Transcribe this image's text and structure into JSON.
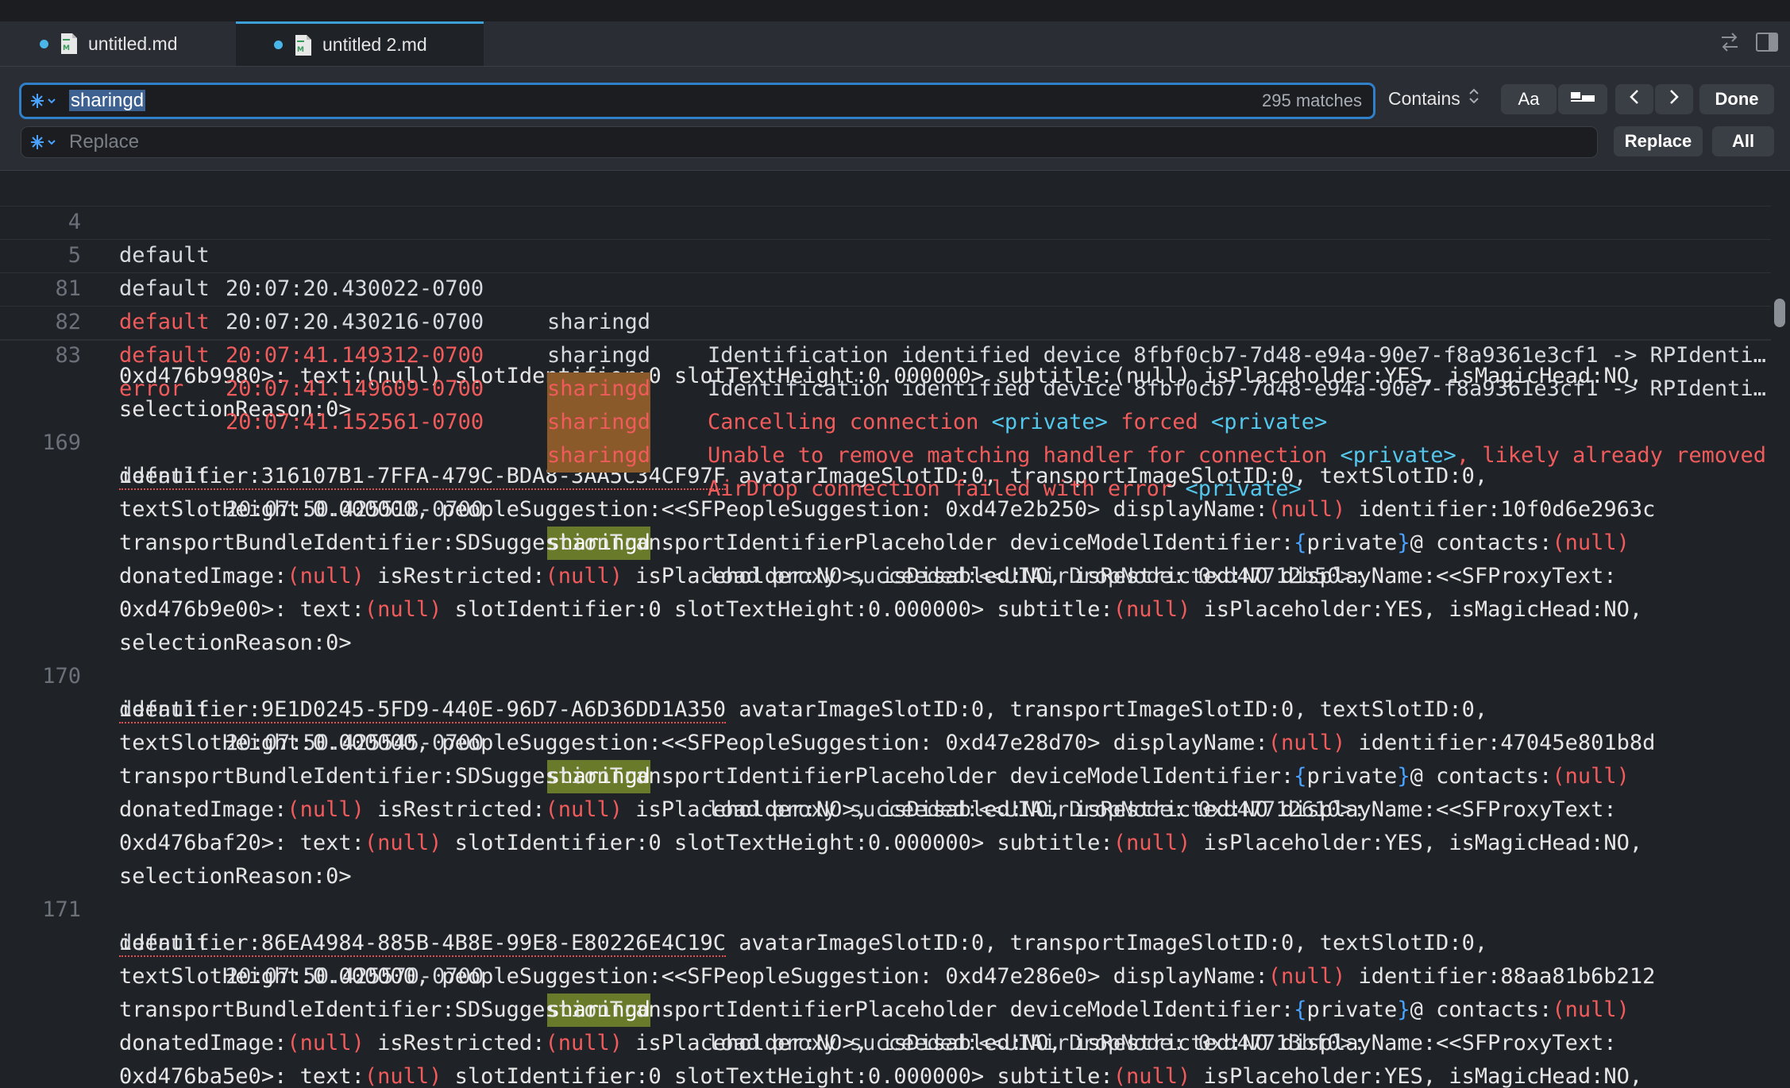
{
  "tabs": [
    {
      "label": "untitled.md",
      "active": false
    },
    {
      "label": "untitled 2.md",
      "active": true
    }
  ],
  "find": {
    "value": "sharingd",
    "matches": "295 matches",
    "mode": "Contains",
    "case_label": "Aa",
    "done_label": "Done"
  },
  "replace": {
    "placeholder": "Replace",
    "replace_label": "Replace",
    "all_label": "All"
  },
  "sticky_lines": [
    {
      "num": "4",
      "level": "default",
      "time": "20:07:20.430022-0700",
      "proc": "sharingd",
      "msg": "Identification identified device 8fbf0cb7-7d48-e94a-90e7-f8a9361e3cf1 -> RPIdenti…"
    },
    {
      "num": "5",
      "level": "default",
      "time": "20:07:20.430216-0700",
      "proc": "sharingd",
      "msg": "Identification identified device 8fbf0cb7-7d48-e94a-90e7-f8a9361e3cf1 -> RPIdenti…"
    },
    {
      "num": "81",
      "level": "default",
      "time": "20:07:41.149312-0700",
      "proc": "sharingd",
      "msg_a": "Cancelling connection ",
      "priv1": "<private>",
      "msg_b": " forced ",
      "priv2": "<private>"
    },
    {
      "num": "82",
      "level": "default",
      "time": "20:07:41.149609-0700",
      "proc": "sharingd",
      "msg_a": "Unable to remove matching handler for connection ",
      "priv1": "<private>",
      "msg_b": ", likely already removed"
    },
    {
      "num": "83",
      "level": "error",
      "time": "20:07:41.152561-0700",
      "proc": "sharingd",
      "msg_a": "AirDrop connection failed with error ",
      "priv1": "<private>"
    }
  ],
  "partial": {
    "top": "0xd476b9980>: text:(null) slotIdentifier:0 slotTextHeight:0.000000> subtitle:(null) isPlaceholder:YES, isMagicHead:NO,",
    "reason": "selectionReason:0>"
  },
  "entries": [
    {
      "num": "169",
      "level": "default",
      "time": "20:07:50.425518-0700",
      "proc": "sharingd",
      "node": "0xd47712b50",
      "identifier": "identifier:316107B1-7FFA-479C-BDA8-3AA5C34CF97F",
      "suggestion": "0xd47e2b250",
      "suggestion_id": "10f0d6e2963c",
      "proxy": "0xd476b9e00"
    },
    {
      "num": "170",
      "level": "default",
      "time": "20:07:50.425545-0700",
      "proc": "sharingd",
      "node": "0xd47712610",
      "identifier": "identifier:9E1D0245-5FD9-440E-96D7-A6D36DD1A350",
      "suggestion": "0xd47e28d70",
      "suggestion_id": "47045e801b8d",
      "proxy": "0xd476baf20"
    },
    {
      "num": "171",
      "level": "default",
      "time": "20:07:50.425570-0700",
      "proc": "sharingd",
      "node": "0xd47713bf0",
      "identifier": "identifier:86EA4984-885B-4B8E-99E8-E80226E4C19C",
      "suggestion": "0xd47e286e0",
      "suggestion_id": "88aa81b6b212",
      "proxy": "0xd476ba5e0"
    }
  ],
  "text": {
    "load_proxy": "load proxy succeeded:<<UIAirDropNode: ",
    "colon_gt": ">:",
    "avatar": " avatarImageSlotID:0, transportImageSlotID:0, textSlotID:0,",
    "slot_height": "textSlotHeight:0.000000, peopleSuggestion:<<SFPeopleSuggestion: ",
    "display_name": "> displayName:",
    "null": "(null)",
    "identifier_label": " identifier:",
    "transport": "transportBundleIdentifier:SDSuggestionTransportIdentifierPlaceholder deviceModelIdentifier:",
    "brace_open": "{",
    "private_word": "private",
    "brace_close": "}",
    "contacts": "@ contacts:",
    "donated": "donatedImage:",
    "is_restricted": " isRestricted:",
    "placeholder_no": " isPlaceholder:NO>, isDisabled:NO, isRestricted:NO displayName:<<SFProxyText:",
    "text_label": ">: text:",
    "slot_id": " slotIdentifier:0 slotTextHeight:0.000000> subtitle:",
    "placeholder_yes": " isPlaceholder:YES, isMagicHead:NO,",
    "reason": "selectionReason:0>"
  }
}
